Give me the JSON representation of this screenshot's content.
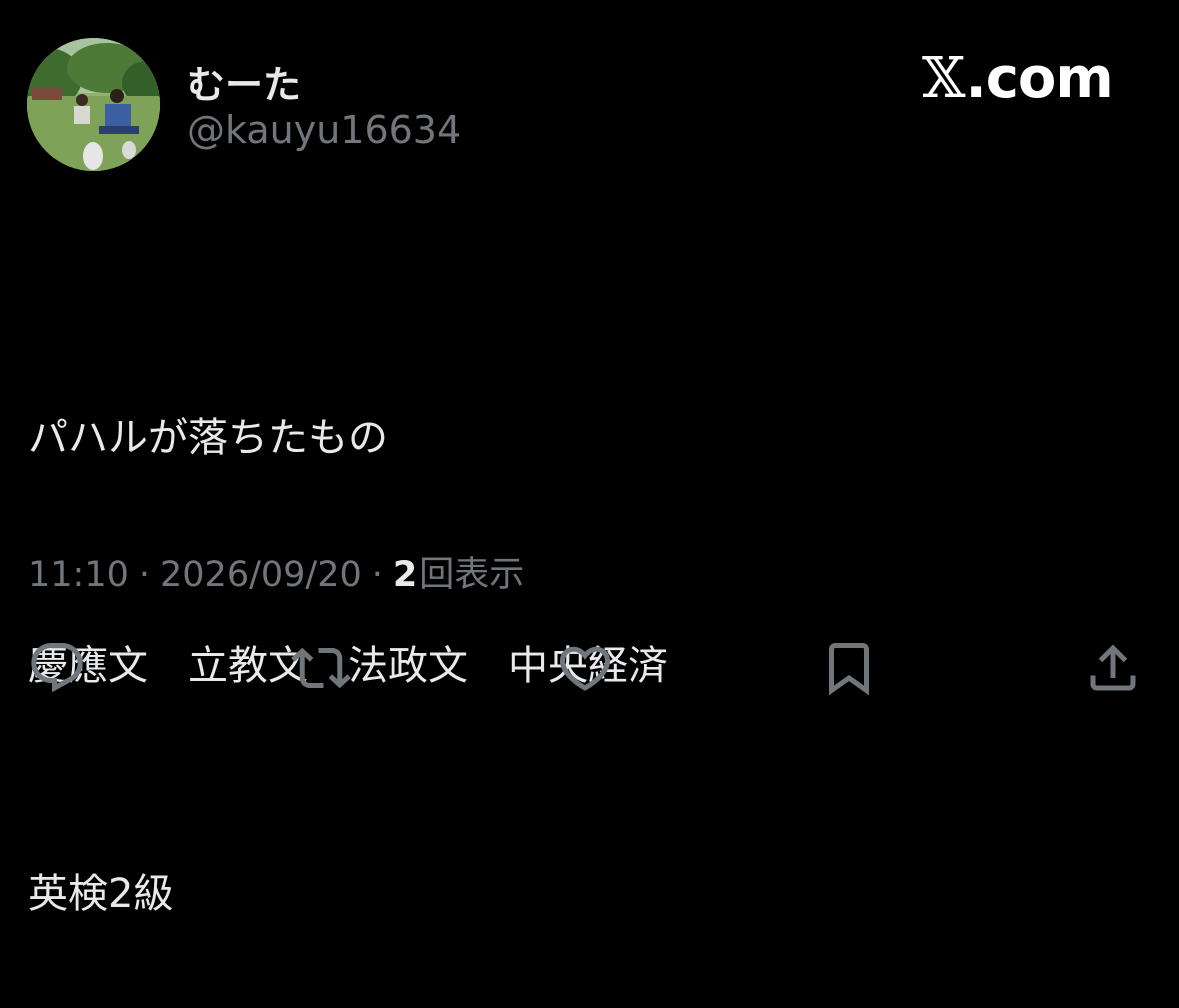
{
  "author": {
    "display_name": "むーた",
    "handle": "@kauyu16634",
    "avatar_icon": "profile-photo-avatar"
  },
  "brand": {
    "text": ".com",
    "mark": "𝕏"
  },
  "tweet": {
    "lines": [
      "パハルが落ちたもの",
      "慶應文　立教文　法政文　中央経済",
      "英検2級"
    ]
  },
  "meta": {
    "time": "11:10",
    "separator": "·",
    "date": "2026/09/20",
    "views_count": "2",
    "views_label": "回表示"
  },
  "actions": [
    {
      "name": "reply",
      "icon": "reply-bubble-icon"
    },
    {
      "name": "repost",
      "icon": "repost-arrows-icon"
    },
    {
      "name": "like",
      "icon": "heart-icon"
    },
    {
      "name": "bookmark",
      "icon": "bookmark-icon"
    },
    {
      "name": "share",
      "icon": "share-upload-icon"
    }
  ],
  "colors": {
    "background": "#000000",
    "primary_text": "#e7e9ea",
    "secondary_text": "#71767b"
  }
}
